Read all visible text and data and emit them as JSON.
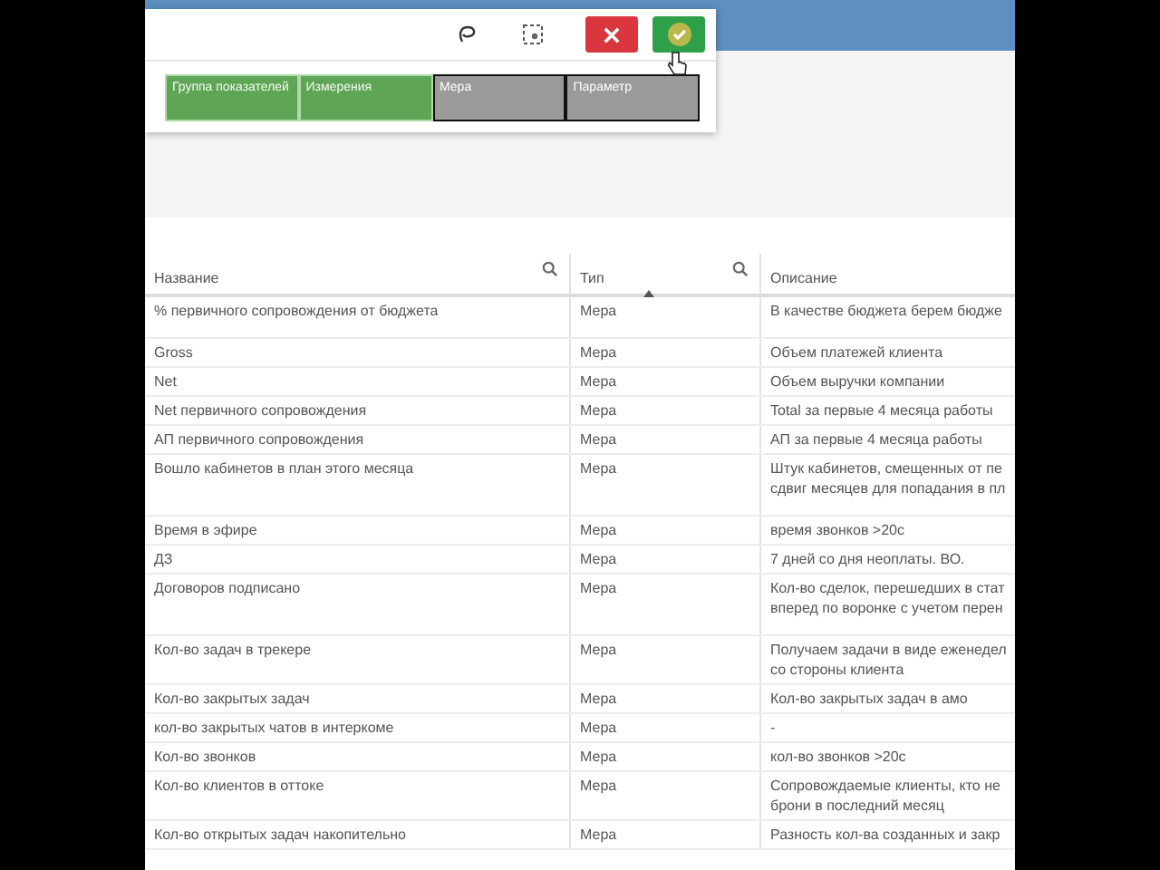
{
  "popup": {
    "fields": [
      {
        "label": "Группа показателей",
        "selected": false
      },
      {
        "label": "Измерения",
        "selected": false
      },
      {
        "label": "Мера",
        "selected": true
      },
      {
        "label": "Параметр",
        "selected": true
      }
    ]
  },
  "table": {
    "columns": [
      {
        "label": "Название",
        "searchable": true
      },
      {
        "label": "Тип",
        "searchable": true,
        "sorted": true
      },
      {
        "label": "Описание"
      }
    ],
    "rows": [
      {
        "name": "% первичного сопровождения от бюджета",
        "type": "Мера",
        "description": [
          "В качестве бюджета берем бюдже"
        ],
        "tall": true
      },
      {
        "name": "Gross",
        "type": "Мера",
        "description": [
          "Объем платежей клиента"
        ]
      },
      {
        "name": "Net",
        "type": "Мера",
        "description": [
          "Объем выручки компании"
        ]
      },
      {
        "name": "Net первичного сопровождения",
        "type": "Мера",
        "description": [
          "Total за первые 4 месяца работы"
        ]
      },
      {
        "name": "АП первичного сопровождения",
        "type": "Мера",
        "description": [
          "АП за первые 4 месяца работы"
        ]
      },
      {
        "name": "Вошло кабинетов в план этого месяца",
        "type": "Мера",
        "description": [
          "Штук кабинетов, смещенных от пе",
          "сдвиг месяцев для попадания в пл"
        ],
        "tall": true
      },
      {
        "name": "Время в эфире",
        "type": "Мера",
        "description": [
          "время звонков >20с"
        ]
      },
      {
        "name": "ДЗ",
        "type": "Мера",
        "description": [
          "7 дней со дня неоплаты. ВО."
        ]
      },
      {
        "name": "Договоров подписано",
        "type": "Мера",
        "description": [
          "Кол-во сделок, перешедших в стат",
          "вперед по воронке с учетом перен"
        ],
        "tall": true
      },
      {
        "name": "Кол-во задач в трекере",
        "type": "Мера",
        "description": [
          "Получаем задачи в виде еженедел",
          "со стороны клиента"
        ]
      },
      {
        "name": "Кол-во закрытых задач",
        "type": "Мера",
        "description": [
          "Кол-во закрытых задач в амо"
        ]
      },
      {
        "name": "кол-во закрытых чатов в интеркоме",
        "type": "Мера",
        "description": [
          "-"
        ]
      },
      {
        "name": "Кол-во звонков",
        "type": "Мера",
        "description": [
          "кол-во звонков >20с"
        ]
      },
      {
        "name": "Кол-во клиентов в оттоке",
        "type": "Мера",
        "description": [
          "Сопровождаемые клиенты, кто не",
          "брони в последний месяц"
        ]
      },
      {
        "name": "Кол-во открытых задач накопительно",
        "type": "Мера",
        "description": [
          "Разность кол-ва созданных и закр"
        ]
      }
    ]
  }
}
